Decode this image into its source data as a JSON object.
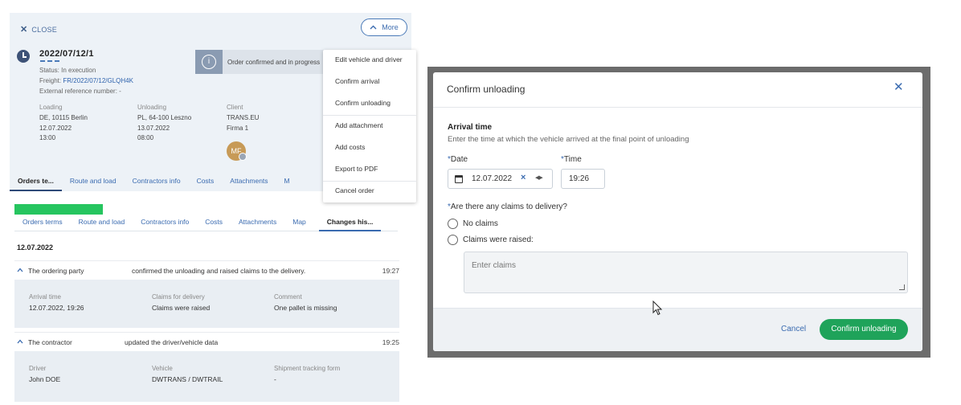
{
  "left": {
    "close_label": "CLOSE",
    "more_label": "More",
    "order_number": "2022/07/12/1",
    "status_line": "Status: In execution",
    "freight_label": "Freight:",
    "freight_link": "FR/2022/07/12/GLQH4K",
    "ext_ref": "External reference number: -",
    "status_banner": "Order confirmed and in progress",
    "loading": {
      "label": "Loading",
      "lines": [
        "DE, 10115 Berlin",
        "12.07.2022",
        "13:00"
      ]
    },
    "unloading": {
      "label": "Unloading",
      "lines": [
        "PL, 64-100 Leszno",
        "13.07.2022",
        "08:00"
      ]
    },
    "client": {
      "label": "Client",
      "lines": [
        "TRANS.EU",
        "Firma 1"
      ]
    },
    "avatar_initials": "MF",
    "tabs_top": [
      "Orders te...",
      "Route and load",
      "Contractors info",
      "Costs",
      "Attachments",
      "M"
    ],
    "dropdown": [
      "Edit vehicle and driver",
      "Confirm arrival",
      "Confirm unloading",
      "Add attachment",
      "Add costs",
      "Export to PDF",
      "Cancel order"
    ],
    "tabs_history": [
      "Orders terms",
      "Route and load",
      "Contractors info",
      "Costs",
      "Attachments",
      "Map",
      "Changes his..."
    ],
    "history_date": "12.07.2022",
    "events": [
      {
        "who": "The ordering party",
        "what": "confirmed the unloading and raised claims to the delivery.",
        "time": "19:27",
        "details": [
          {
            "label": "Arrival time",
            "value": "12.07.2022, 19:26"
          },
          {
            "label": "Claims for delivery",
            "value": "Claims were raised"
          },
          {
            "label": "Comment",
            "value": "One pallet is missing"
          }
        ]
      },
      {
        "who": "The contractor",
        "what": "updated the driver/vehicle data",
        "time": "19:25",
        "details": [
          {
            "label": "Driver",
            "value": "John DOE"
          },
          {
            "label": "Vehicle",
            "value": "DWTRANS / DWTRAIL"
          },
          {
            "label": "Shipment tracking form",
            "value": "-"
          }
        ]
      }
    ]
  },
  "dialog": {
    "title": "Confirm unloading",
    "section_title": "Arrival time",
    "section_desc": "Enter the time at which the vehicle arrived at the final point of unloading",
    "date_label": "Date",
    "date_value": "12.07.2022",
    "time_label": "Time",
    "time_value": "19:26",
    "claims_question": "Are there any claims to delivery?",
    "option_no_claims": "No claims",
    "option_claims_raised": "Claims were raised:",
    "claims_placeholder": "Enter claims",
    "cancel_label": "Cancel",
    "confirm_label": "Confirm unloading"
  },
  "colors": {
    "accent": "#3a6bb0",
    "confirm_green": "#1fa35a",
    "status_bar_green": "#26c55f"
  }
}
